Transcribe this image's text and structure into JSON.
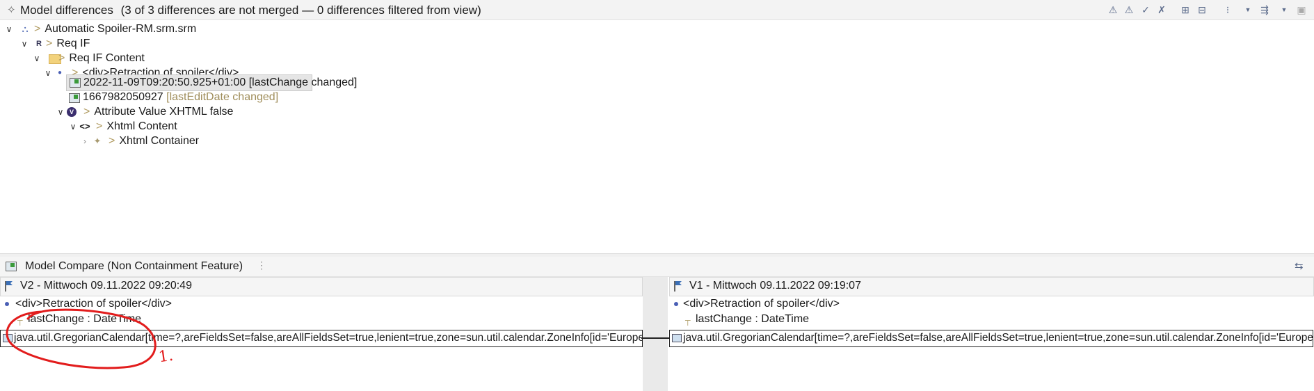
{
  "top_view": {
    "title": "Model differences",
    "summary": "(3 of 3 differences are not merged — 0 differences filtered from view)"
  },
  "tree": {
    "root": "Automatic Spoiler-RM.srm.srm",
    "req_if": "Req IF",
    "req_if_content": "Req IF Content",
    "div_node": "<div>Retraction of spoiler</div>",
    "change_1_value": "2022-11-09T09:20:50.925+01:00",
    "change_1_label": "[lastChange changed]",
    "change_2_value": "1667982050927",
    "change_2_label": "[lastEditDate changed]",
    "attr_value": "Attribute Value XHTML false",
    "xhtml_content": "Xhtml Content",
    "xhtml_container": "Xhtml Container",
    "separator": ">"
  },
  "bottom_view": {
    "title": "Model Compare (Non Containment Feature)"
  },
  "left_pane": {
    "header": "V2  -  Mittwoch 09.11.2022 09:20:49",
    "element": "<div>Retraction of spoiler</div>",
    "feature": "lastChange : DateTime",
    "value": "java.util.GregorianCalendar[time=?,areFieldsSet=false,areAllFieldsSet=true,lenient=true,zone=sun.util.calendar.ZoneInfo[id='Europe/Berlin'"
  },
  "right_pane": {
    "header": "V1  -  Mittwoch 09.11.2022 09:19:07",
    "element": "<div>Retraction of spoiler</div>",
    "feature": "lastChange : DateTime",
    "value": "java.util.GregorianCalendar[time=?,areFieldsSet=false,areAllFieldsSet=true,lenient=true,zone=sun.util.calendar.ZoneInfo[id='Europe/Berlin'"
  },
  "annotation": {
    "mark": "1."
  },
  "colors": {
    "annotation": "#e21c1c",
    "change_label": "#9f8d5a",
    "separator": "#b09a60"
  }
}
